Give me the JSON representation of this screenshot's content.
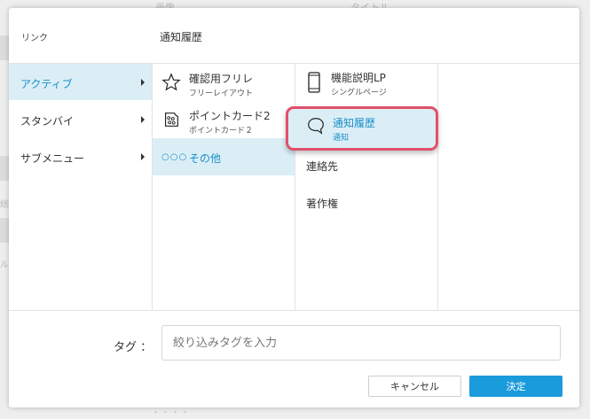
{
  "background": {
    "col_a": "画像",
    "col_b": "タイトル",
    "side_chars": [
      "総",
      "ル"
    ],
    "bottom_text": "・・・・"
  },
  "link": {
    "label": "リンク",
    "value": "通知履歴"
  },
  "menu": [
    {
      "label": "アクティブ",
      "active": true
    },
    {
      "label": "スタンバイ",
      "active": false
    },
    {
      "label": "サブメニュー",
      "active": false
    }
  ],
  "submenu": [
    {
      "title": "確認用フリレ",
      "subtitle": "フリーレイアウト",
      "icon": "star-icon"
    },
    {
      "title": "ポイントカード2",
      "subtitle": "ポイントカード２",
      "icon": "stamp-card-icon"
    },
    {
      "dots": "○○○",
      "title": "その他",
      "active": true
    }
  ],
  "pages": [
    {
      "title": "機能説明LP",
      "subtitle": "シングルページ",
      "icon": "smartphone-icon"
    },
    {
      "title": "通知履歴",
      "subtitle": "通知",
      "icon": "speech-bubble-icon",
      "selected": true
    },
    {
      "title": "連絡先"
    },
    {
      "title": "著作権"
    }
  ],
  "tag": {
    "label": "タグ ：",
    "placeholder": "絞り込みタグを入力"
  },
  "buttons": {
    "cancel": "キャンセル",
    "ok": "決定"
  },
  "colors": {
    "accent": "#1a9bdc",
    "active_bg": "#dbeef6",
    "highlight_border": "#e2506b"
  }
}
